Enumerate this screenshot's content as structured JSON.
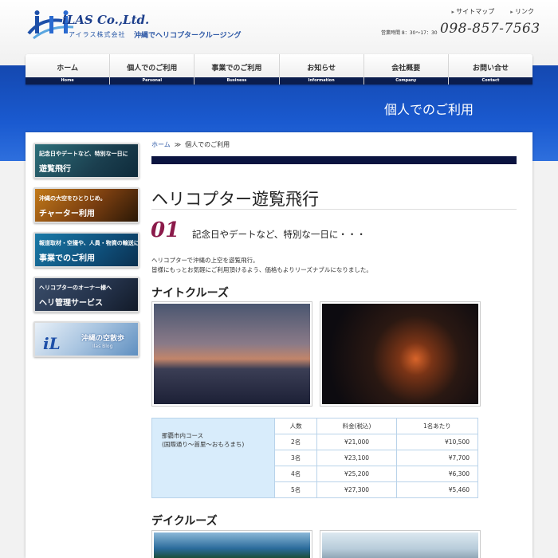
{
  "header": {
    "logo_text": "iLAS Co.,Ltd.",
    "logo_sub": "アイラス株式会社",
    "tagline": "沖縄でヘリコプタークルージング",
    "top_links": [
      "サイトマップ",
      "リンク"
    ],
    "hours": "営業時間 8：30〜17：30",
    "phone": "098-857-7563"
  },
  "nav": [
    {
      "jp": "ホーム",
      "en": "Home"
    },
    {
      "jp": "個人でのご利用",
      "en": "Personal"
    },
    {
      "jp": "事業でのご利用",
      "en": "Business"
    },
    {
      "jp": "お知らせ",
      "en": "Information"
    },
    {
      "jp": "会社概要",
      "en": "Company"
    },
    {
      "jp": "お問い合せ",
      "en": "Contact"
    }
  ],
  "band_title": "個人でのご利用",
  "sidebar": {
    "b1_line1": "記念日やデートなど、特別な一日に",
    "b1_line2": "遊覧飛行",
    "b2_line1": "沖縄の大空をひとりじめ。",
    "b2_line2": "チャーター利用",
    "b3_line1": "報道取材・空撮や、人員・物資の輸送に",
    "b3_line2": "事業でのご利用",
    "b4_line1": "ヘリコプターのオーナー様へ",
    "b4_line2": "ヘリ管理サービス",
    "b5_line1": "沖縄の空散歩",
    "b5_line2": "Ilas Blog"
  },
  "breadcrumb": {
    "home": "ホーム",
    "sep": "≫",
    "current": "個人でのご利用"
  },
  "main": {
    "title": "ヘリコプター遊覧飛行",
    "num": "01",
    "num_text": "記念日やデートなど、特別な一日に・・・",
    "intro_1": "ヘリコプターで沖縄の上空を遊覧飛行。",
    "intro_2": "皆様にもっとお気軽にご利用頂けるよう、価格もよりリーズナブルになりました。",
    "night_title": "ナイトクルーズ",
    "day_title": "デイクルーズ"
  },
  "price_table": {
    "course_1": "那覇市内コース",
    "course_2": "(国際通り〜首里〜おもろまち)",
    "headers": [
      "人数",
      "料金(税込)",
      "1名あたり"
    ],
    "rows": [
      [
        "2名",
        "¥21,000",
        "¥10,500"
      ],
      [
        "3名",
        "¥23,100",
        "¥7,700"
      ],
      [
        "4名",
        "¥25,200",
        "¥6,300"
      ],
      [
        "5名",
        "¥27,300",
        "¥5,460"
      ]
    ]
  }
}
